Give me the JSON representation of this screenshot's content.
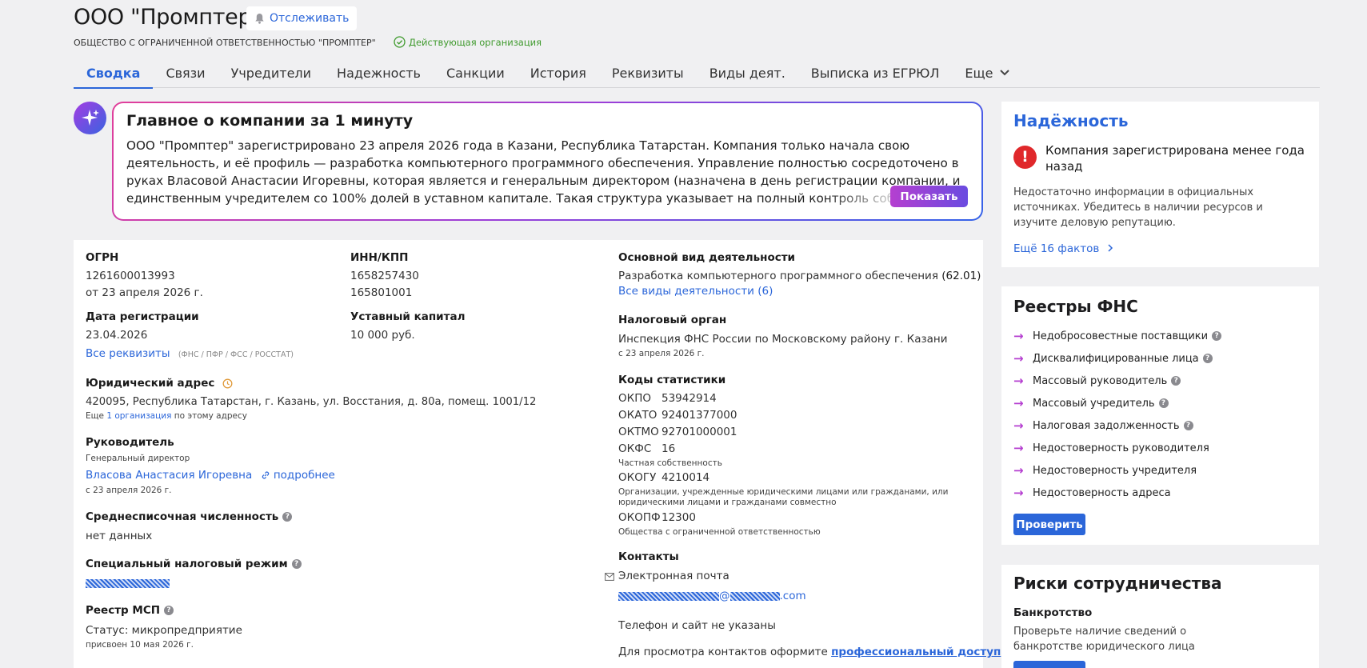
{
  "header": {
    "title": "ООО \"Промптер\"",
    "follow_label": "Отслеживать",
    "full_name": "ОБЩЕСТВО С ОГРАНИЧЕННОЙ ОТВЕТСТВЕННОСТЬЮ \"ПРОМПТЕР\"",
    "status": "Действующая организация"
  },
  "tabs": [
    {
      "label": "Сводка",
      "active": true
    },
    {
      "label": "Связи"
    },
    {
      "label": "Учредители"
    },
    {
      "label": "Надежность"
    },
    {
      "label": "Санкции"
    },
    {
      "label": "История"
    },
    {
      "label": "Реквизиты"
    },
    {
      "label": "Виды деят."
    },
    {
      "label": "Выписка из ЕГРЮЛ"
    },
    {
      "label": "Еще"
    }
  ],
  "ai_summary": {
    "title": "Главное о компании за 1 минуту",
    "text": "ООО \"Промптер\" зарегистрировано 23 апреля 2026 года в Казани, Республика Татарстан. Компания только начала свою деятельность, и её профиль — разработка компьютерного программного обеспечения. Управление полностью сосредоточено в руках Власовой Анастасии Игоревны, которая является и генеральным директором (назначена в день регистрации компании, и единственным учредителем со 100% долей в уставном капитале. Такая структура указывает на полный контроль собственника",
    "show_label": "Показать"
  },
  "main": {
    "ogrn": {
      "label": "ОГРН",
      "value": "1261600013993",
      "date": "от 23 апреля 2026 г."
    },
    "inn": {
      "label": "ИНН/КПП",
      "inn": "1658257430",
      "kpp": "165801001"
    },
    "reg_date": {
      "label": "Дата регистрации",
      "value": "23.04.2026",
      "link": "Все реквизиты",
      "note": "(ФНС / ПФР / ФСС / РОССТАТ)"
    },
    "capital": {
      "label": "Уставный капитал",
      "value": "10 000 руб."
    },
    "address": {
      "label": "Юридический адрес",
      "value": "420095, Республика Татарстан, г. Казань, ул. Восстания, д. 80а, помещ. 1001/12",
      "more_prefix": "Еще",
      "more_link": "1 организация",
      "more_suffix": "по этому адресу"
    },
    "head": {
      "label": "Руководитель",
      "position": "Генеральный директор",
      "name": "Власова Анастасия Игоревна",
      "details": "подробнее",
      "since": "с 23 апреля 2026 г."
    },
    "employees": {
      "label": "Среднесписочная численность",
      "value": "нет данных"
    },
    "tax_mode": {
      "label": "Специальный налоговый режим"
    },
    "msp": {
      "label": "Реестр МСП",
      "status": "Статус: микропредприятие",
      "date": "присвоен 10 мая 2026 г."
    },
    "activity": {
      "label": "Основной вид деятельности",
      "value": "Разработка компьютерного программного обеспечения",
      "code": "(62.01)",
      "link": "Все виды деятельности (6)"
    },
    "tax_office": {
      "label": "Налоговый орган",
      "value": "Инспекция ФНС России по Московскому району г. Казани",
      "since": "с 23 апреля 2026 г."
    },
    "stats": {
      "label": "Коды статистики",
      "okpo": {
        "name": "ОКПО",
        "value": "53942914"
      },
      "okato": {
        "name": "ОКАТО",
        "value": "92401377000"
      },
      "oktmo": {
        "name": "ОКТМО",
        "value": "92701000001"
      },
      "okfs": {
        "name": "ОКФС",
        "value": "16",
        "note": "Частная собственность"
      },
      "okogu": {
        "name": "ОКОГУ",
        "value": "4210014",
        "note1": "Организации, учрежденные юридическими лицами или гражданами, или",
        "note2": "юридическими лицами и гражданами совместно"
      },
      "okopf": {
        "name": "ОКОПФ",
        "value": "12300",
        "note": "Общества с ограниченной ответственностью"
      }
    },
    "contacts": {
      "label": "Контакты",
      "email_label": "Электронная почта",
      "email_at": "@",
      "email_domain": ".com",
      "phone": "Телефон и сайт не указаны",
      "access_prefix": "Для просмотра контактов оформите",
      "access_link": "профессиональный доступ"
    }
  },
  "reliability": {
    "title": "Надёжность",
    "alert": "Компания зарегистрирована менее года назад",
    "desc": "Недостаточно информации в официальных источниках. Убедитесь в наличии ресурсов и изучите деловую репутацию.",
    "more": "Ещё 16 фактов"
  },
  "fns": {
    "title": "Реестры ФНС",
    "items": [
      {
        "label": "Недобросовестные поставщики",
        "help": true
      },
      {
        "label": "Дисквалифицированные лица",
        "help": true
      },
      {
        "label": "Массовый руководитель",
        "help": true
      },
      {
        "label": "Массовый учредитель",
        "help": true
      },
      {
        "label": "Налоговая задолженность",
        "help": true
      },
      {
        "label": "Недостоверность руководителя"
      },
      {
        "label": "Недостоверность учредителя"
      },
      {
        "label": "Недостоверность адреса"
      }
    ],
    "check_label": "Проверить"
  },
  "risks": {
    "title": "Риски сотрудничества",
    "bankruptcy": "Банкротство",
    "bankruptcy_desc": "Проверьте наличие сведений о банкротстве юридического лица"
  },
  "colors": {
    "accent": "#2b66d9",
    "status": "#3f9a2d",
    "alert": "#e0282b",
    "gradient_start": "#b53fd0",
    "gradient_end": "#3563e9"
  }
}
